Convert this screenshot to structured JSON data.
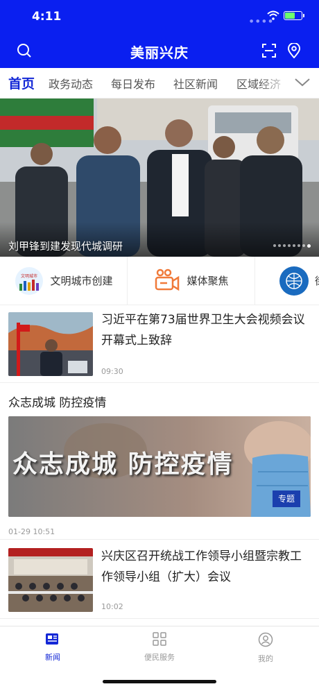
{
  "status_bar": {
    "time": "4:11"
  },
  "header": {
    "title": "美丽兴庆"
  },
  "tabs": [
    {
      "label": "首页",
      "active": true
    },
    {
      "label": "政务动态"
    },
    {
      "label": "每日发布"
    },
    {
      "label": "社区新闻"
    },
    {
      "label": "区域经济"
    }
  ],
  "banner": {
    "caption": "刘甲锋到建发现代城调研",
    "slides": 8,
    "active_slide": 8
  },
  "channels": [
    {
      "label": "文明城市创建",
      "icon": "civilized-city-logo",
      "logo_text": "文明城市"
    },
    {
      "label": "媒体聚焦",
      "icon": "camera-icon"
    },
    {
      "label": "街",
      "icon": "globe-icon"
    }
  ],
  "news": [
    {
      "title": "习近平在第73届世界卫生大会视频会议开幕式上致辞",
      "time": "09:30"
    },
    {
      "title": "兴庆区召开统战工作领导小组暨宗教工作领导小组（扩大）会议",
      "time": "10:02"
    }
  ],
  "topic": {
    "section_title": "众志成城 防控疫情",
    "image_text": "众志成城 防控疫情",
    "badge": "专题",
    "time": "01-29 10:51"
  },
  "tabbar": [
    {
      "label": "新闻",
      "icon": "news-icon",
      "active": true
    },
    {
      "label": "便民服务",
      "icon": "grid-icon"
    },
    {
      "label": "我的",
      "icon": "user-icon"
    }
  ],
  "colors": {
    "brand": "#0a1ff0",
    "active_tab": "#1327d6",
    "battery": "#6dff6d"
  }
}
